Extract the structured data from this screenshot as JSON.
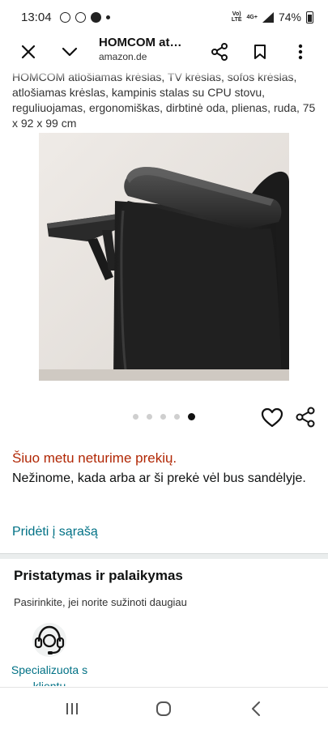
{
  "status_bar": {
    "time": "13:04",
    "network_top": "Vo)",
    "network_bottom": "LTE",
    "network_gen": "4G+",
    "battery": "74%"
  },
  "header": {
    "title": "HOMCOM at…",
    "url": "amazon.de"
  },
  "product": {
    "description": "HOMCOM atlošiamas krėslas, TV krėslas, sofos krėslas, atlošiamas krėslas, kampinis stalas su CPU stovu, reguliuojamas, ergonomiškas, dirbtinė oda, plienas, ruda, 75 x 92 x 99 cm",
    "image_count": 5,
    "active_image": 5
  },
  "availability": {
    "status": "Šiuo metu neturime prekių.",
    "note": "Nežinome, kada arba ar ši prekė vėl bus sandėlyje."
  },
  "actions": {
    "add_to_list": "Pridėti į sąrašą"
  },
  "delivery": {
    "title": "Pristatymas ir palaikymas",
    "subtitle": "Pasirinkite, jei norite sužinoti daugiau",
    "support_label": "Specializuota s klientu"
  },
  "icons": {
    "close": "close-icon",
    "collapse": "chevron-down-icon",
    "share": "share-icon",
    "bookmark": "bookmark-icon",
    "menu": "more-vert-icon",
    "favorite": "heart-icon",
    "support": "headset-icon"
  },
  "colors": {
    "unavailable": "#b12704",
    "link": "#007185",
    "dot_active": "#111111",
    "dot_inactive": "#cfcfcf"
  }
}
